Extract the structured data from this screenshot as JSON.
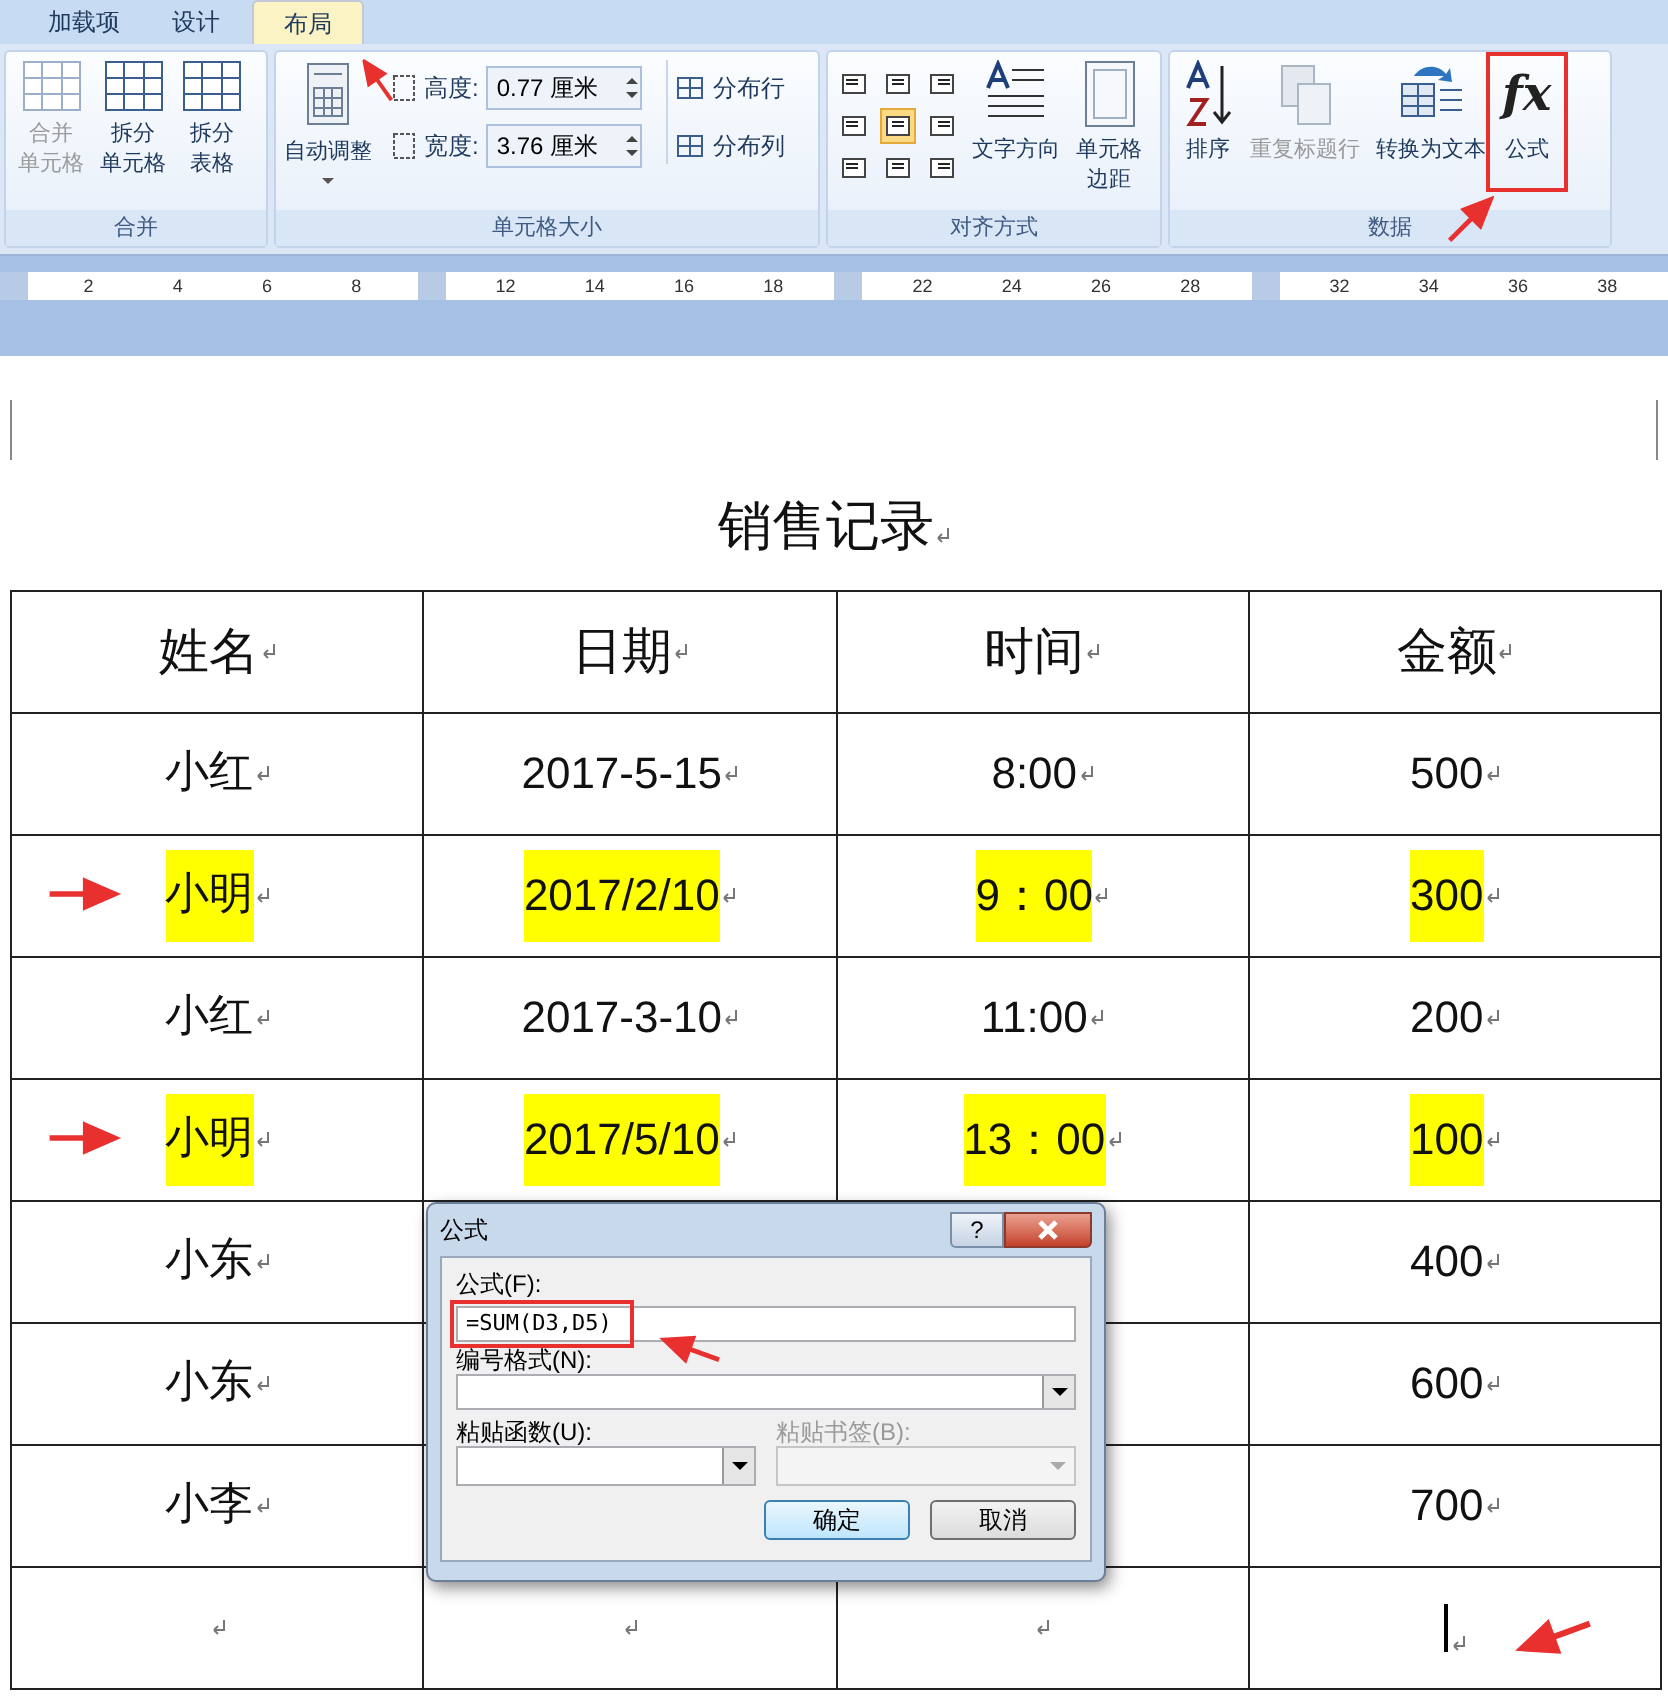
{
  "tabs": [
    {
      "label": "加载项",
      "selected": false
    },
    {
      "label": "设计",
      "selected": false
    },
    {
      "label": "布局",
      "selected": true
    }
  ],
  "groups": [
    {
      "kind": "merge",
      "title": "合并",
      "buttons": [
        {
          "label": [
            "合并",
            "单元格"
          ],
          "disabled": true
        },
        {
          "label": [
            "拆分",
            "单元格"
          ],
          "disabled": false
        },
        {
          "label": [
            "拆分",
            "表格"
          ],
          "disabled": false
        }
      ]
    },
    {
      "kind": "size",
      "title": "单元格大小",
      "autofit": "自动调整",
      "height_label": "高度:",
      "height_value": "0.77 厘米",
      "width_label": "宽度:",
      "width_value": "3.76 厘米",
      "distribute": [
        "分布行",
        "分布列"
      ]
    },
    {
      "kind": "align",
      "title": "对齐方式",
      "cells": [
        {
          "selected": false
        },
        {
          "selected": false
        },
        {
          "selected": false
        },
        {
          "selected": false
        },
        {
          "selected": true
        },
        {
          "selected": false
        },
        {
          "selected": false
        },
        {
          "selected": false
        },
        {
          "selected": false
        }
      ],
      "buttons": [
        [
          "文字方向"
        ],
        [
          "单元格",
          "边距"
        ]
      ]
    },
    {
      "kind": "data",
      "title": "数据",
      "buttons": [
        {
          "label": [
            "排序"
          ],
          "disabled": false
        },
        {
          "label": [
            "重复标题行"
          ],
          "disabled": true
        },
        {
          "label": [
            "转换为文本"
          ],
          "disabled": false
        },
        {
          "label": [
            "公式"
          ],
          "disabled": false,
          "glyph": "fx"
        }
      ]
    }
  ],
  "ruler": [
    [
      "2",
      "4",
      "6",
      "8"
    ],
    [
      "12",
      "14",
      "16",
      "18"
    ],
    [
      "22",
      "24",
      "26",
      "28"
    ],
    [
      "32",
      "34",
      "36",
      "38"
    ]
  ],
  "title": "销售记录",
  "table": {
    "columns": [
      "姓名",
      "日期",
      "时间",
      "金额"
    ],
    "rows": [
      {
        "cells": [
          "小红",
          "2017-5-15",
          "8:00",
          "500"
        ],
        "highlighted": false
      },
      {
        "cells": [
          "小明",
          "2017/2/10",
          "9：00",
          "300"
        ],
        "highlighted": true
      },
      {
        "cells": [
          "小红",
          "2017-3-10",
          "11:00",
          "200"
        ],
        "highlighted": false
      },
      {
        "cells": [
          "小明",
          "2017/5/10",
          "13：00",
          "100"
        ],
        "highlighted": true
      },
      {
        "cells": [
          "小东",
          null,
          null,
          "400"
        ],
        "highlighted": false
      },
      {
        "cells": [
          "小东",
          null,
          null,
          "600"
        ],
        "highlighted": false
      },
      {
        "cells": [
          "小李",
          null,
          null,
          "700"
        ],
        "highlighted": false
      },
      {
        "cells": [
          null,
          null,
          null,
          null
        ],
        "highlighted": false,
        "cursor": true
      }
    ]
  },
  "dialog": {
    "title": "公式",
    "help": "?",
    "formula_label": "公式(F):",
    "formula_value": "=SUM(D3,D5)",
    "format_label": "编号格式(N):",
    "function_label": "粘贴函数(U):",
    "bookmark_label": "粘贴书签(B):",
    "bookmark_disabled": true,
    "ok": "确定",
    "cancel": "取消"
  }
}
